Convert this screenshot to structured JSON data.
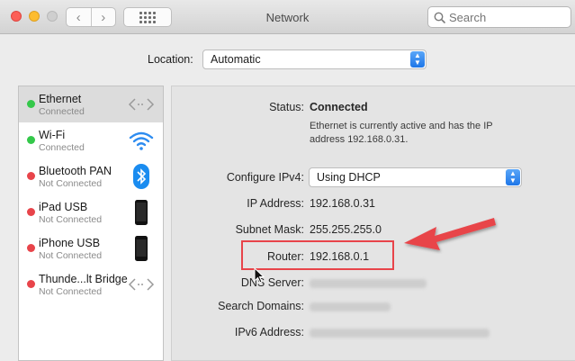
{
  "window": {
    "title": "Network",
    "search_placeholder": "Search"
  },
  "location": {
    "label": "Location:",
    "value": "Automatic"
  },
  "sidebar": {
    "items": [
      {
        "name": "Ethernet",
        "status": "Connected",
        "status_color": "#34c84a",
        "icon": "ethernet-icon"
      },
      {
        "name": "Wi-Fi",
        "status": "Connected",
        "status_color": "#34c84a",
        "icon": "wifi-icon"
      },
      {
        "name": "Bluetooth PAN",
        "status": "Not Connected",
        "status_color": "#e8444a",
        "icon": "bluetooth-icon"
      },
      {
        "name": "iPad USB",
        "status": "Not Connected",
        "status_color": "#e8444a",
        "icon": "ipad-icon"
      },
      {
        "name": "iPhone USB",
        "status": "Not Connected",
        "status_color": "#e8444a",
        "icon": "iphone-icon"
      },
      {
        "name": "Thunde...lt Bridge",
        "status": "Not Connected",
        "status_color": "#e8444a",
        "icon": "thunderbolt-bridge-icon"
      }
    ]
  },
  "details": {
    "status_label": "Status:",
    "status_value": "Connected",
    "status_description": "Ethernet is currently active and has the IP address 192.168.0.31.",
    "configure_label": "Configure IPv4:",
    "configure_value": "Using DHCP",
    "ip_label": "IP Address:",
    "ip_value": "192.168.0.31",
    "subnet_label": "Subnet Mask:",
    "subnet_value": "255.255.255.0",
    "router_label": "Router:",
    "router_value": "192.168.0.1",
    "dns_label": "DNS Server:",
    "search_domains_label": "Search Domains:",
    "ipv6_label": "IPv6 Address:"
  },
  "colors": {
    "accent": "#1e76e8",
    "annotation": "#e8444a"
  }
}
